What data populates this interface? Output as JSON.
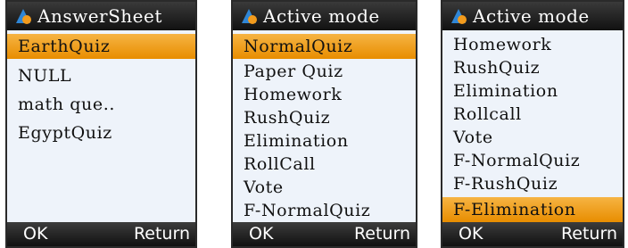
{
  "screens": [
    {
      "title": "AnswerSheet",
      "items": [
        "EarthQuiz",
        "NULL",
        "math que..",
        "EgyptQuiz"
      ],
      "selected_index": 0,
      "softkeys": {
        "left": "OK",
        "right": "Return"
      }
    },
    {
      "title": "Active mode",
      "items": [
        "NormalQuiz",
        "Paper Quiz",
        "Homework",
        "RushQuiz",
        "Elimination",
        "RollCall",
        "Vote",
        "F-NormalQuiz"
      ],
      "selected_index": 0,
      "softkeys": {
        "left": "OK",
        "right": "Return"
      }
    },
    {
      "title": "Active mode",
      "items": [
        "Homework",
        "RushQuiz",
        "Elimination",
        "Rollcall",
        "Vote",
        "F-NormalQuiz",
        "F-RushQuiz",
        "F-Elimination"
      ],
      "selected_index": 7,
      "softkeys": {
        "left": "OK",
        "right": "Return"
      }
    }
  ],
  "colors": {
    "selection": "#f0a020",
    "background": "#eef3fa",
    "bar": "#1a1a1a",
    "icon_blue": "#2f86d6",
    "icon_orange": "#f29b1d"
  },
  "icons": {
    "title_icon": "app-logo-icon"
  }
}
